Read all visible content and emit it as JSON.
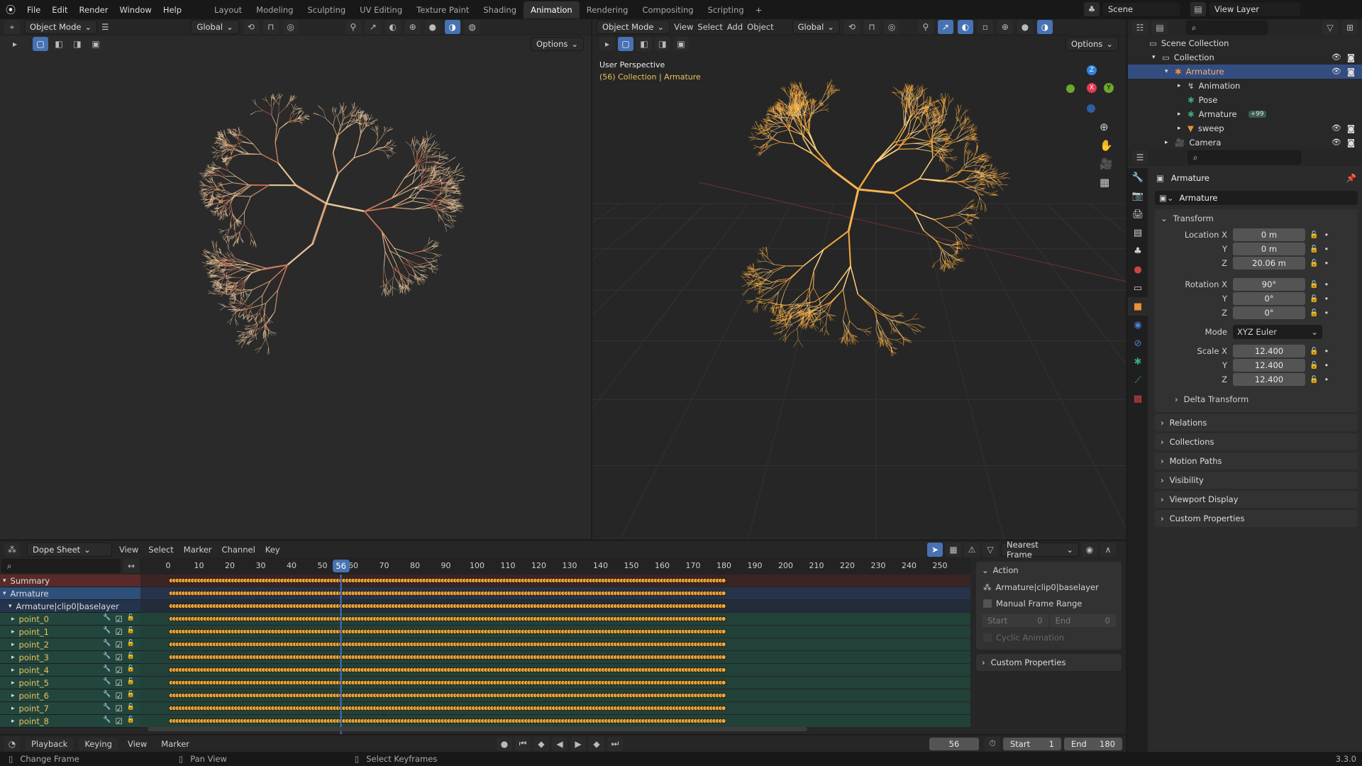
{
  "menu": [
    "File",
    "Edit",
    "Render",
    "Window",
    "Help"
  ],
  "workspaces": [
    "Layout",
    "Modeling",
    "Sculpting",
    "UV Editing",
    "Texture Paint",
    "Shading",
    "Animation",
    "Rendering",
    "Compositing",
    "Scripting"
  ],
  "active_workspace": "Animation",
  "scene": "Scene",
  "view_layer": "View Layer",
  "left_viewport": {
    "mode": "Object Mode",
    "orientation": "Global",
    "options": "Options"
  },
  "right_viewport": {
    "mode": "Object Mode",
    "menus": [
      "View",
      "Select",
      "Add",
      "Object"
    ],
    "orientation": "Global",
    "options": "Options",
    "overlay_title": "User Perspective",
    "overlay_sub": "(56) Collection | Armature",
    "gizmo": {
      "x": "X",
      "y": "Y",
      "z": "Z"
    }
  },
  "outliner": {
    "items": [
      {
        "label": "Scene Collection",
        "indent": 0
      },
      {
        "label": "Collection",
        "indent": 1
      },
      {
        "label": "Armature",
        "indent": 2,
        "selected": true
      },
      {
        "label": "Animation",
        "indent": 3
      },
      {
        "label": "Pose",
        "indent": 3
      },
      {
        "label": "Armature",
        "indent": 3,
        "badge": "+99"
      },
      {
        "label": "sweep",
        "indent": 3
      },
      {
        "label": "Camera",
        "indent": 2
      }
    ]
  },
  "properties": {
    "object_name": "Armature",
    "datablock": "Armature",
    "transform_label": "Transform",
    "location": {
      "label": "Location X",
      "x": "0 m",
      "y": "0 m",
      "z": "20.06 m"
    },
    "rotation": {
      "label": "Rotation X",
      "x": "90°",
      "y": "0°",
      "z": "0°"
    },
    "mode_label": "Mode",
    "mode": "XYZ Euler",
    "scale": {
      "label": "Scale X",
      "x": "12.400",
      "y": "12.400",
      "z": "12.400"
    },
    "axis": {
      "y": "Y",
      "z": "Z"
    },
    "delta": "Delta Transform",
    "panels": [
      "Relations",
      "Collections",
      "Motion Paths",
      "Visibility",
      "Viewport Display",
      "Custom Properties"
    ]
  },
  "dopesheet": {
    "editor": "Dope Sheet",
    "menus": [
      "View",
      "Select",
      "Marker",
      "Channel",
      "Key"
    ],
    "snap": "Nearest Frame",
    "current_frame": 56,
    "ticks": [
      0,
      10,
      20,
      30,
      40,
      50,
      60,
      70,
      80,
      90,
      100,
      110,
      120,
      130,
      140,
      150,
      160,
      170,
      180,
      190,
      200,
      210,
      220,
      230,
      240,
      250
    ],
    "key_start": 1,
    "key_end": 180,
    "channels": {
      "summary": "Summary",
      "object": "Armature",
      "action": "Armature|clip0|baselayer",
      "groups": [
        "point_0",
        "point_1",
        "point_2",
        "point_3",
        "point_4",
        "point_5",
        "point_6",
        "point_7",
        "point_8"
      ]
    },
    "sidebar": {
      "title": "Action",
      "action_name": "Armature|clip0|baselayer",
      "manual": "Manual Frame Range",
      "start_label": "Start",
      "start": "0",
      "end_label": "End",
      "end": "0",
      "cyclic": "Cyclic Animation",
      "custom": "Custom Properties"
    }
  },
  "timeline": {
    "menus": [
      "Playback",
      "Keying",
      "View",
      "Marker"
    ],
    "frame": "56",
    "start_label": "Start",
    "start": "1",
    "end_label": "End",
    "end": "180"
  },
  "status": {
    "left": "Change Frame",
    "mid": "Pan View",
    "right": "Select Keyframes",
    "version": "3.3.0"
  },
  "colors": {
    "accent": "#4772b3",
    "keyframe": "#e8a33a",
    "summary": "#5a2a2a",
    "green_rows": "#22463d"
  }
}
